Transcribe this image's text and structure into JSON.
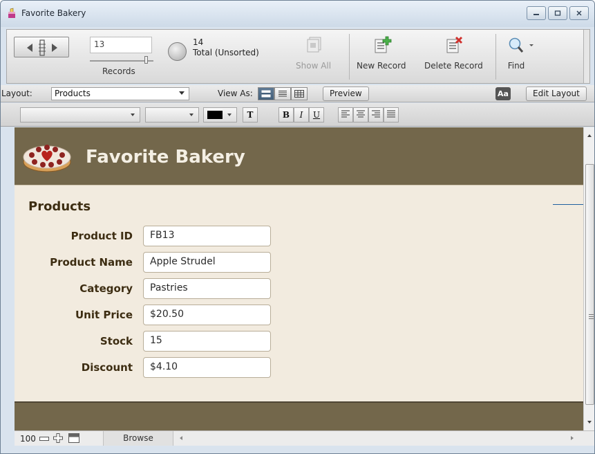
{
  "window": {
    "title": "Favorite Bakery"
  },
  "toolbar": {
    "current_record": "13",
    "records_label": "Records",
    "found_count": "14",
    "found_label": "Total (Unsorted)",
    "show_all_label": "Show All",
    "new_record_label": "New Record",
    "delete_record_label": "Delete Record",
    "find_label": "Find"
  },
  "layoutbar": {
    "layout_label": "Layout:",
    "layout_value": "Products",
    "view_as_label": "View As:",
    "preview_label": "Preview",
    "aa_label": "Aa",
    "edit_layout_label": "Edit Layout"
  },
  "formatbar": {
    "text_button": "T",
    "bold": "B",
    "italic": "I",
    "underline": "U"
  },
  "content": {
    "brand": "Favorite Bakery",
    "section_title": "Products",
    "fields": [
      {
        "label": "Product ID",
        "value": "FB13"
      },
      {
        "label": "Product Name",
        "value": "Apple Strudel"
      },
      {
        "label": "Category",
        "value": "Pastries"
      },
      {
        "label": "Unit Price",
        "value": "$20.50"
      },
      {
        "label": "Stock",
        "value": "15"
      },
      {
        "label": "Discount",
        "value": "$4.10"
      }
    ]
  },
  "bottombar": {
    "zoom": "100",
    "mode": "Browse"
  },
  "colors": {
    "header_band": "#73674b",
    "content_bg": "#f2ebdf",
    "label_text": "#3d2d12",
    "brand_text": "#f4efe4"
  },
  "icons": [
    "app-icon",
    "minimize-icon",
    "maximize-icon",
    "close-icon",
    "book-icon",
    "pie-icon",
    "show-all-icon",
    "new-record-icon",
    "delete-record-icon",
    "magnifier-icon",
    "cake-logo-icon",
    "zoom-out-icon",
    "zoom-in-icon",
    "toggle-statusbar-icon"
  ]
}
